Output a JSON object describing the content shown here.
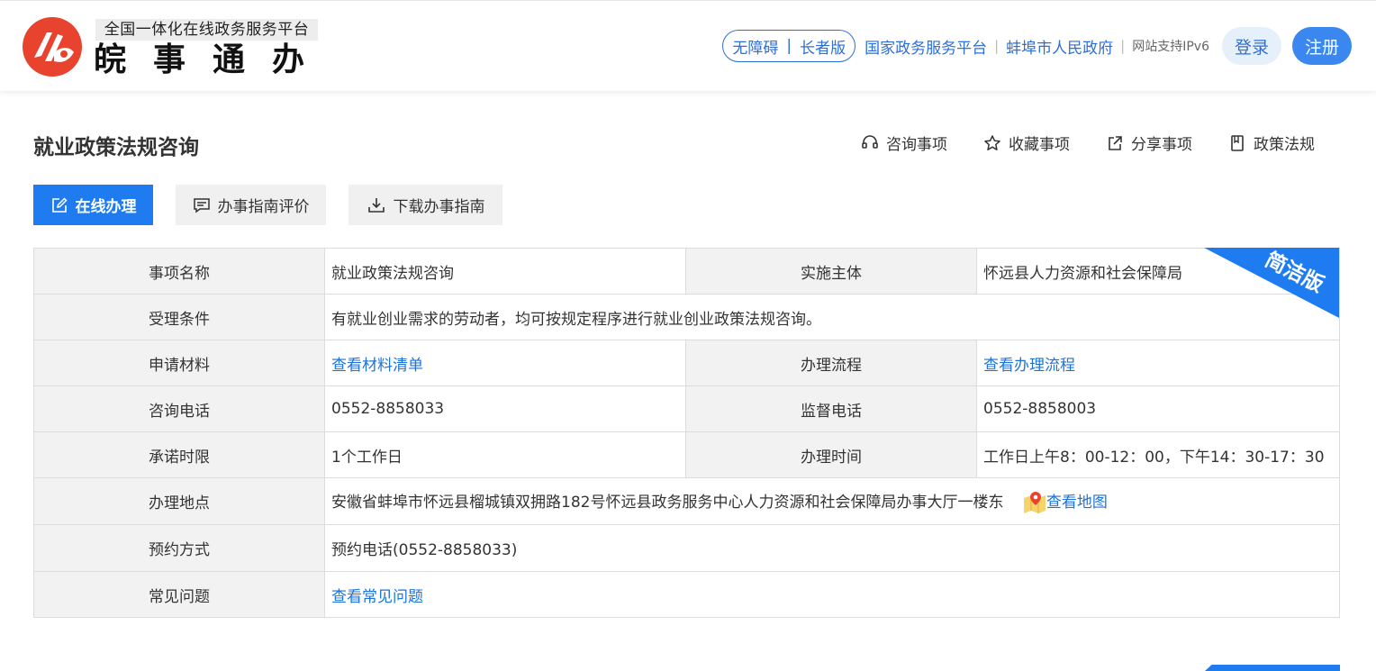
{
  "header": {
    "platform_subtitle": "全国一体化在线政务服务平台",
    "brand_title": "皖事通办",
    "accessibility": "无障碍",
    "elder_mode": "长者版",
    "link_national": "国家政务服务平台",
    "link_city": "蚌埠市人民政府",
    "ipv6_note": "网站支持IPv6",
    "login": "登录",
    "register": "注册"
  },
  "page": {
    "title": "就业政策法规咨询",
    "actions": {
      "consult": "咨询事项",
      "favorite": "收藏事项",
      "share": "分享事项",
      "policy": "政策法规"
    },
    "buttons": {
      "online": "在线办理",
      "evaluate": "办事指南评价",
      "download": "下载办事指南"
    },
    "ribbon_label": "简洁版"
  },
  "info": {
    "name_label": "事项名称",
    "name_value": "就业政策法规咨询",
    "subject_label": "实施主体",
    "subject_value": "怀远县人力资源和社会保障局",
    "condition_label": "受理条件",
    "condition_value": "有就业创业需求的劳动者，均可按规定程序进行就业创业政策法规咨询。",
    "materials_label": "申请材料",
    "materials_link": "查看材料清单",
    "process_label": "办理流程",
    "process_link": "查看办理流程",
    "phone_label": "咨询电话",
    "phone_value": "0552-8858033",
    "supervise_label": "监督电话",
    "supervise_value": "0552-8858003",
    "limit_label": "承诺时限",
    "limit_value": "1个工作日",
    "hours_label": "办理时间",
    "hours_value": "工作日上午8：00-12：00，下午14：30-17：30",
    "location_label": "办理地点",
    "location_value": "安徽省蚌埠市怀远县榴城镇双拥路182号怀远县政务服务中心人力资源和社会保障局办事大厅一楼东",
    "map_link": "查看地图",
    "booking_label": "预约方式",
    "booking_value": "预约电话(0552-8858033)",
    "faq_label": "常见问题",
    "faq_link": "查看常见问题"
  },
  "colors": {
    "brand_red": "#e8432e",
    "link_blue": "#1e73d8",
    "primary_blue": "#1e7cf0"
  }
}
